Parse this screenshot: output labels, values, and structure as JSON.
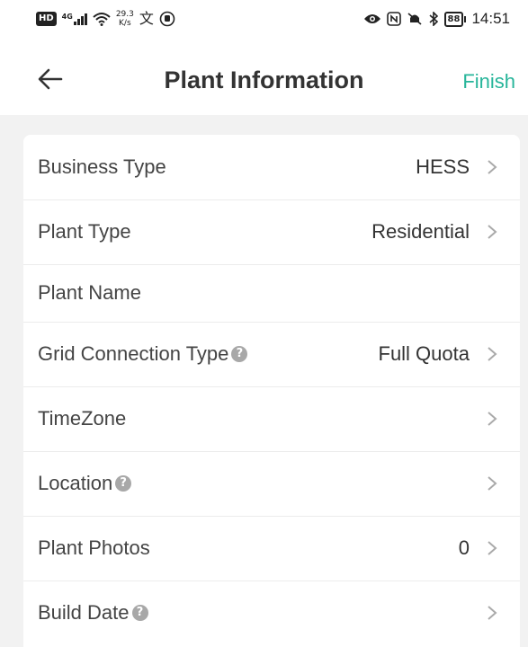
{
  "status_bar": {
    "hd_badge": "HD",
    "network": "4G",
    "speed_value": "29.3",
    "speed_unit": "K/s",
    "battery": "88",
    "time": "14:51"
  },
  "header": {
    "title": "Plant Information",
    "finish_label": "Finish"
  },
  "colors": {
    "accent": "#27b59a",
    "background": "#f2f2f2",
    "card": "#ffffff"
  },
  "rows": [
    {
      "label": "Business Type",
      "value": "HESS",
      "help": false,
      "chevron": true
    },
    {
      "label": "Plant Type",
      "value": "Residential",
      "help": false,
      "chevron": true
    },
    {
      "label": "Plant Name",
      "value": "",
      "help": false,
      "chevron": false
    },
    {
      "label": "Grid Connection Type",
      "value": "Full Quota",
      "help": true,
      "chevron": true
    },
    {
      "label": "TimeZone",
      "value": "",
      "help": false,
      "chevron": true
    },
    {
      "label": "Location",
      "value": "",
      "help": true,
      "chevron": true
    },
    {
      "label": "Plant Photos",
      "value": "0",
      "help": false,
      "chevron": true
    },
    {
      "label": "Build Date",
      "value": "",
      "help": true,
      "chevron": true
    }
  ],
  "help_glyph": "?"
}
